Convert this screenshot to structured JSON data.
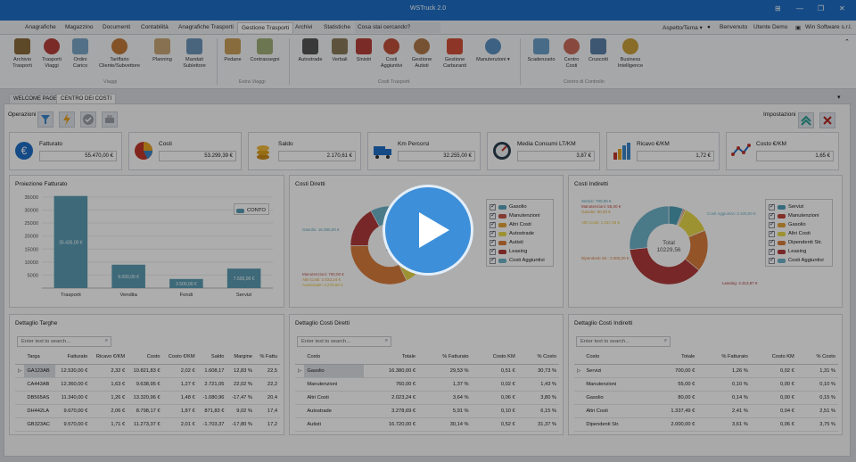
{
  "app": {
    "title": "WSTruck 2.0"
  },
  "window_controls": [
    "⊞",
    "—",
    "❐",
    "✕"
  ],
  "menu": {
    "items": [
      "Anagrafiche",
      "Magazzino",
      "Documenti",
      "Contabilità",
      "Anagrafiche Trasporti",
      "Gestione Trasporti",
      "Archivi",
      "Statistiche"
    ],
    "search_placeholder": "Cosa stai cercando?",
    "right": {
      "theme": "Aspetto/Tema",
      "welcome": "Benvenuto",
      "user": "Utente Demo",
      "company": "Win Software s.r.l."
    }
  },
  "ribbon": {
    "viaggi": [
      "Archivio Trasporti",
      "Trasporti Viaggi",
      "Ordini Carico",
      "Tariffario Cliente/Subvettore",
      "Planning",
      "Mandati Sublettore"
    ],
    "extra": [
      "Pedane",
      "Contrassegni"
    ],
    "costi": [
      "Autostrade",
      "Verbali",
      "Sinistri",
      "Costi Aggiuntivi",
      "Gestione Autisti",
      "Gestione Carburanti",
      "Manutenzioni"
    ],
    "controllo": [
      "Scadenzario",
      "Centro Costi",
      "Cruscotti",
      "Business Intelligence"
    ],
    "groups": [
      "Viaggi",
      "Extra Viaggi",
      "Costi Trasporti",
      "Centro di Controllo"
    ]
  },
  "tabs": [
    "WELCOME PAGE",
    "CENTRO DEI COSTI"
  ],
  "toolbar": {
    "operazioni": "Operazioni",
    "impostazioni": "Impostazioni"
  },
  "kpis": [
    {
      "label": "Fatturato",
      "value": "55.470,00 €"
    },
    {
      "label": "Costi",
      "value": "53.299,39 €"
    },
    {
      "label": "Saldo",
      "value": "2.170,61 €"
    },
    {
      "label": "Km Percorsi",
      "value": "32.255,00 €"
    },
    {
      "label": "Media Consumi LT/KM",
      "value": "3,87 €"
    },
    {
      "label": "Ricavo €/KM",
      "value": "1,72 €"
    },
    {
      "label": "Costo €/KM",
      "value": "1,65 €"
    }
  ],
  "panels": {
    "proiezione": "Proiezione Fatturato",
    "costi_diretti": "Costi Diretti",
    "costi_indiretti": "Costi Indiretti",
    "dettaglio_targhe": "Dettaglio Targhe",
    "dettaglio_diretti": "Dettaglio Costi Diretti",
    "dettaglio_indiretti": "Dettaglio Costi Indiretti"
  },
  "chart_data": [
    {
      "type": "bar",
      "title": "Proiezione Fatturato",
      "categories": [
        "Trasporti",
        "Vendita",
        "Fondi",
        "Servizi"
      ],
      "series": [
        {
          "name": "CONTO",
          "values": [
            35435,
            9000,
            3500,
            7500
          ]
        }
      ],
      "data_labels": [
        "35.435,00 €",
        "9.000,00 €",
        "3.500,00 €",
        "7.500,00 €"
      ],
      "ylim": [
        0,
        35000
      ],
      "yticks": [
        5000,
        10000,
        15000,
        20000,
        25000,
        30000,
        35000
      ],
      "ylabel": "",
      "color": "#5a9bb3",
      "legend": "top-right"
    },
    {
      "type": "pie",
      "title": "Costi Diretti",
      "labels": [
        "Gasolio",
        "Manutenzioni",
        "Altri Costi",
        "Autostrade",
        "Autisti",
        "Leasing",
        "Costi Aggiuntivi"
      ],
      "values": [
        16380,
        760,
        2023.24,
        3278.69,
        16720,
        9000,
        4175.63
      ],
      "colors": [
        "#5aa3b8",
        "#c05a4b",
        "#e3a23a",
        "#e8d84a",
        "#d97c3c",
        "#b03a3a",
        "#6db3c9"
      ],
      "center_label": "Tota",
      "center_value": "43",
      "legend": "right"
    },
    {
      "type": "pie",
      "title": "Costi Indiretti",
      "labels": [
        "Servizi",
        "Manutenzioni",
        "Gasolio",
        "Altri Costi",
        "Dipendenti Str.",
        "Leasing",
        "Costi Aggiuntivi"
      ],
      "values": [
        700,
        55,
        80,
        1337.49,
        2000,
        4313.87,
        3100
      ],
      "colors": [
        "#4f9fb7",
        "#c0473b",
        "#e3a23a",
        "#e8d84a",
        "#d97c3c",
        "#b03a3a",
        "#6db3c9"
      ],
      "center_label": "Total",
      "center_value": "10229,56",
      "legend": "right"
    }
  ],
  "pie_labels_direct": [
    "Gasolio: 16.380,00 €",
    "Manutenzioni: 760,00 €",
    "Altri Costi: 2.023,24 €",
    "Autostrade: 3.278,69 €"
  ],
  "pie_labels_indirect": [
    "Servizi: 700,00 €",
    "Manutenzioni: 55,00 €",
    "Gasolio: 80,00 €",
    "Altri Costi: 1.337,49 €",
    "Dipendenti Str.: 2.000,00 €",
    "Costi Aggiuntivi: 3.100,00 €",
    "Leasing: 4.313,87 €"
  ],
  "search_placeholder": "Enter text to search...",
  "targhe_table": {
    "headers": [
      "Targa",
      "Fatturato",
      "Ricavo €/KM",
      "Costo",
      "Costo €/KM",
      "Saldo",
      "Margine",
      "% Fattu"
    ],
    "rows": [
      [
        "GA123AB",
        "12.530,00 €",
        "2,32 €",
        "10.821,83 €",
        "2,02 €",
        "1.608,17",
        "12,83 %",
        "22,5"
      ],
      [
        "CA443AB",
        "12.360,00 €",
        "1,63 €",
        "9.638,95 €",
        "1,27 €",
        "2.721,05",
        "22,02 %",
        "22,2"
      ],
      [
        "DB565AS",
        "11.340,00 €",
        "1,26 €",
        "13.320,96 €",
        "1,48 €",
        "-1.080,96",
        "-17,47 %",
        "20,4"
      ],
      [
        "DH442LA",
        "9.670,00 €",
        "2,06 €",
        "8.798,17 €",
        "1,87 €",
        "871,83 €",
        "9,02 %",
        "17,4"
      ],
      [
        "GB323AC",
        "9.570,00 €",
        "1,71 €",
        "11.273,37 €",
        "2,01 €",
        "-1.703,37",
        "-17,80 %",
        "17,2"
      ]
    ]
  },
  "diretti_table": {
    "headers": [
      "Costo",
      "Totale",
      "% Fatturato",
      "Costo KM",
      "% Costo"
    ],
    "rows": [
      [
        "Gasolio",
        "16.380,00 €",
        "29,53 %",
        "0,51 €",
        "30,73 %"
      ],
      [
        "Manutenzioni",
        "760,00 €",
        "1,37 %",
        "0,02 €",
        "1,43 %"
      ],
      [
        "Altri Costi",
        "2.023,24 €",
        "3,64 %",
        "0,06 €",
        "3,80 %"
      ],
      [
        "Autostrade",
        "3.278,69 €",
        "5,91 %",
        "0,10 €",
        "6,15 %"
      ],
      [
        "Autisti",
        "16.720,00 €",
        "30,14 %",
        "0,52 €",
        "31,37 %"
      ]
    ]
  },
  "indiretti_table": {
    "headers": [
      "Costo",
      "Totale",
      "% Fatturato",
      "Costo KM",
      "% Costo"
    ],
    "rows": [
      [
        "Servizi",
        "700,00 €",
        "1,26 %",
        "0,02 €",
        "1,31 %"
      ],
      [
        "Manutenzioni",
        "55,00 €",
        "0,10 %",
        "0,00 €",
        "0,10 %"
      ],
      [
        "Gasolio",
        "80,00 €",
        "0,14 %",
        "0,00 €",
        "0,15 %"
      ],
      [
        "Altri Costi",
        "1.337,49 €",
        "2,41 %",
        "0,04 €",
        "2,51 %"
      ],
      [
        "Dipendenti Str.",
        "2.000,00 €",
        "3,61 %",
        "0,06 €",
        "3,75 %"
      ]
    ]
  }
}
